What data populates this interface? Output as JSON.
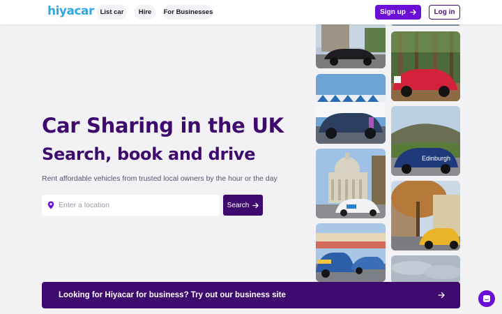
{
  "header": {
    "logo": "hiyacar",
    "nav": [
      {
        "label": "List car"
      },
      {
        "label": "Hire"
      },
      {
        "label": "For Businesses"
      }
    ],
    "signup_label": "Sign up",
    "login_label": "Log in"
  },
  "hero": {
    "title": "Car Sharing in the UK",
    "subtitle": "Search, book and drive",
    "description": "Rent affordable vehicles from trusted local owners by the hour or the day",
    "search": {
      "placeholder": "Enter a location",
      "value": "",
      "button_label": "Search"
    }
  },
  "gallery": {
    "photos": [
      {
        "subject": "black SUV outside stone building"
      },
      {
        "subject": "blue car near beach huts"
      },
      {
        "subject": "white car at St Paul's Cathedral"
      },
      {
        "subject": "blue cars on street"
      },
      {
        "subject": "blue car partial top"
      },
      {
        "subject": "red car in forest"
      },
      {
        "subject": "blue Edinburgh car with hill"
      },
      {
        "subject": "yellow car under autumn tree"
      },
      {
        "subject": "cloudy sky"
      }
    ],
    "edinburgh_label": "Edinburgh"
  },
  "banner": {
    "text": "Looking for Hiyacar for business? Try out our business site"
  },
  "icons": {
    "location": "map-pin-icon",
    "arrow": "arrow-right-icon",
    "chat": "chat-icon"
  },
  "colors": {
    "brand_purple": "#3e0a6e",
    "accent_purple": "#6b0fd6",
    "logo_blue": "#2ea8e6",
    "background": "#f2f2f4"
  }
}
